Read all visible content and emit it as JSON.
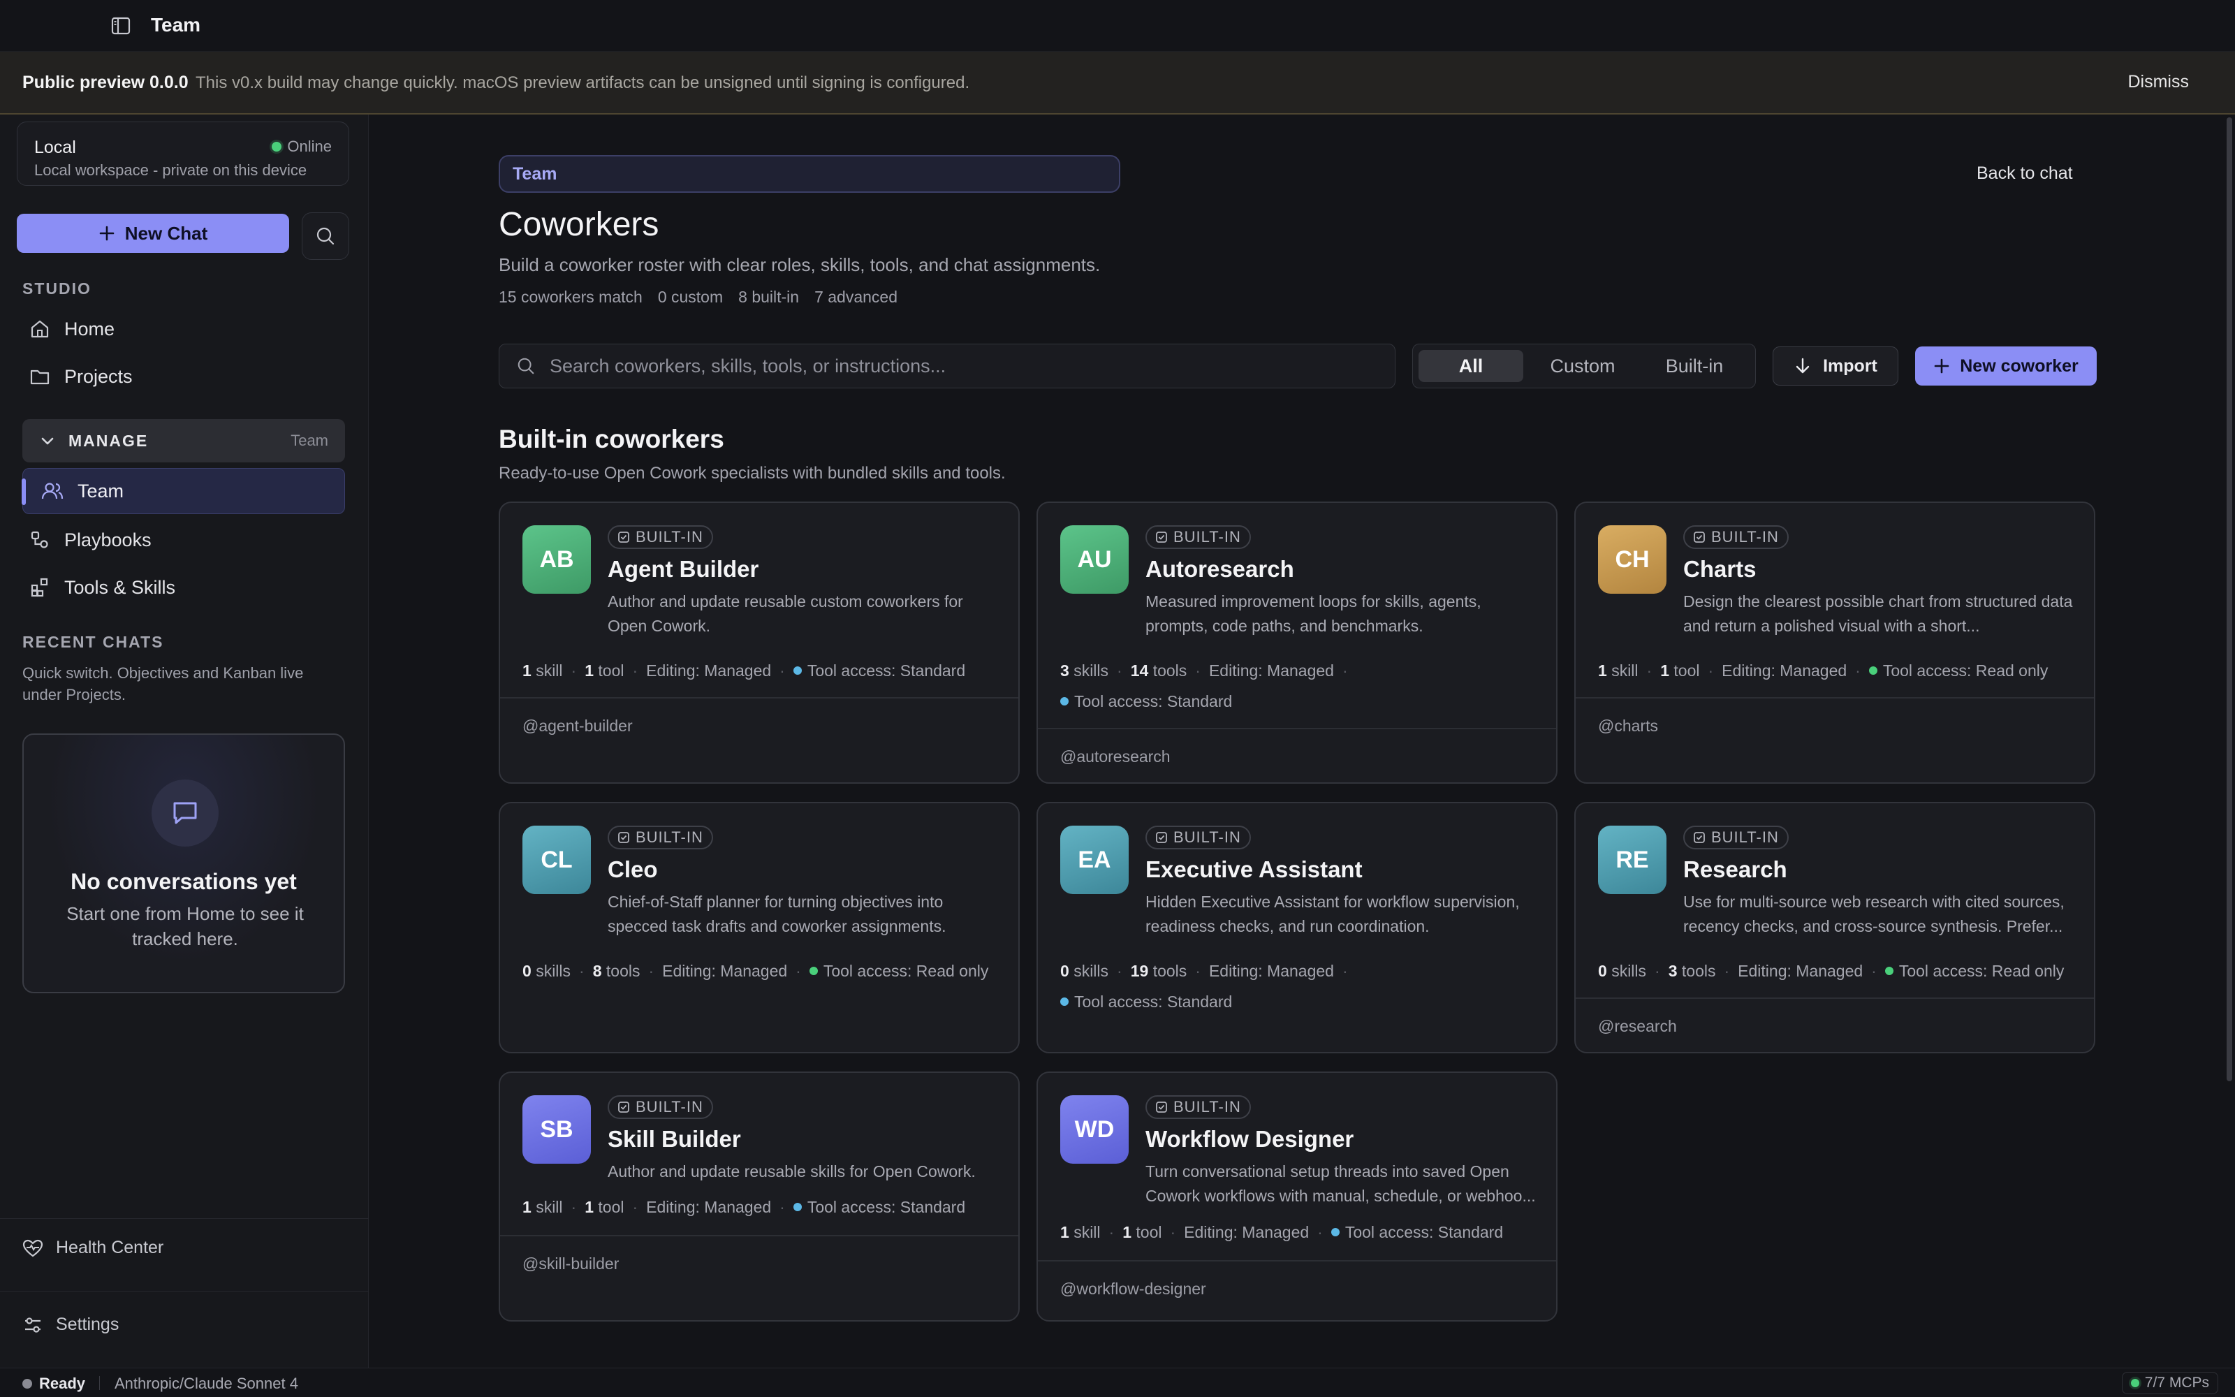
{
  "window": {
    "title": "Team"
  },
  "banner": {
    "title": "Public preview 0.0.0",
    "text": "This v0.x build may change quickly. macOS preview artifacts can be unsigned until signing is configured.",
    "dismiss": "Dismiss"
  },
  "sidebar": {
    "workspace": {
      "name": "Local",
      "status": "Online",
      "desc": "Local workspace - private on this device"
    },
    "new_chat": "New Chat",
    "studio_label": "STUDIO",
    "home": "Home",
    "projects": "Projects",
    "manage_label": "MANAGE",
    "manage_context": "Team",
    "team": "Team",
    "playbooks": "Playbooks",
    "tools_skills": "Tools & Skills",
    "recent_label": "RECENT CHATS",
    "recent_desc": "Quick switch. Objectives and Kanban live under Projects.",
    "empty_title": "No conversations yet",
    "empty_sub": "Start one from Home to see it tracked here.",
    "health_center": "Health Center",
    "settings": "Settings"
  },
  "main": {
    "breadcrumb": "Team",
    "back": "Back to chat",
    "title": "Coworkers",
    "subtitle": "Build a coworker roster with clear roles, skills, tools, and chat assignments.",
    "stats": [
      "15 coworkers match",
      "0 custom",
      "8 built-in",
      "7 advanced"
    ],
    "search_placeholder": "Search coworkers, skills, tools, or instructions...",
    "filters": [
      "All",
      "Custom",
      "Built-in"
    ],
    "import": "Import",
    "new_coworker": "New coworker",
    "section_title": "Built-in coworkers",
    "section_sub": "Ready-to-use Open Cowork specialists with bundled skills and tools."
  },
  "colors": {
    "accent": "#8b8ef5",
    "green_avatar": "#4fb37a",
    "gold_avatar": "#c99a52",
    "teal_avatar": "#4a9db0",
    "purple_avatar": "#6b6fe0",
    "access_standard": "#5cb8e6",
    "access_readonly": "#4ad07b"
  },
  "cards": [
    {
      "initials": "AB",
      "badge": "BUILT-IN",
      "name": "Agent Builder",
      "desc": "Author and update reusable custom coworkers for Open Cowork.",
      "skills_n": "1",
      "skills_unit": "skill",
      "tools_n": "1",
      "tools_unit": "tool",
      "editing": "Editing: Managed",
      "access": "Tool access: Standard",
      "handle": "@agent-builder"
    },
    {
      "initials": "AU",
      "badge": "BUILT-IN",
      "name": "Autoresearch",
      "desc": "Measured improvement loops for skills, agents, prompts, code paths, and benchmarks.",
      "skills_n": "3",
      "skills_unit": "skills",
      "tools_n": "14",
      "tools_unit": "tools",
      "editing": "Editing: Managed",
      "access": "Tool access: Standard",
      "handle": "@autoresearch"
    },
    {
      "initials": "CH",
      "badge": "BUILT-IN",
      "name": "Charts",
      "desc": "Design the clearest possible chart from structured data and return a polished visual with a short...",
      "skills_n": "1",
      "skills_unit": "skill",
      "tools_n": "1",
      "tools_unit": "tool",
      "editing": "Editing: Managed",
      "access": "Tool access: Read only",
      "handle": "@charts"
    },
    {
      "initials": "CL",
      "badge": "BUILT-IN",
      "name": "Cleo",
      "desc": "Chief-of-Staff planner for turning objectives into specced task drafts and coworker assignments.",
      "skills_n": "0",
      "skills_unit": "skills",
      "tools_n": "8",
      "tools_unit": "tools",
      "editing": "Editing: Managed",
      "access": "Tool access: Read only",
      "handle": ""
    },
    {
      "initials": "EA",
      "badge": "BUILT-IN",
      "name": "Executive Assistant",
      "desc": "Hidden Executive Assistant for workflow supervision, readiness checks, and run coordination.",
      "skills_n": "0",
      "skills_unit": "skills",
      "tools_n": "19",
      "tools_unit": "tools",
      "editing": "Editing: Managed",
      "access": "Tool access: Standard",
      "handle": ""
    },
    {
      "initials": "RE",
      "badge": "BUILT-IN",
      "name": "Research",
      "desc": "Use for multi-source web research with cited sources, recency checks, and cross-source synthesis. Prefer...",
      "skills_n": "0",
      "skills_unit": "skills",
      "tools_n": "3",
      "tools_unit": "tools",
      "editing": "Editing: Managed",
      "access": "Tool access: Read only",
      "handle": "@research"
    },
    {
      "initials": "SB",
      "badge": "BUILT-IN",
      "name": "Skill Builder",
      "desc": "Author and update reusable skills for Open Cowork.",
      "skills_n": "1",
      "skills_unit": "skill",
      "tools_n": "1",
      "tools_unit": "tool",
      "editing": "Editing: Managed",
      "access": "Tool access: Standard",
      "handle": "@skill-builder"
    },
    {
      "initials": "WD",
      "badge": "BUILT-IN",
      "name": "Workflow Designer",
      "desc": "Turn conversational setup threads into saved Open Cowork workflows with manual, schedule, or webhoo...",
      "skills_n": "1",
      "skills_unit": "skill",
      "tools_n": "1",
      "tools_unit": "tool",
      "editing": "Editing: Managed",
      "access": "Tool access: Standard",
      "handle": "@workflow-designer"
    }
  ],
  "statusbar": {
    "ready": "Ready",
    "model": "Anthropic/Claude Sonnet 4",
    "mcps": "7/7 MCPs"
  }
}
